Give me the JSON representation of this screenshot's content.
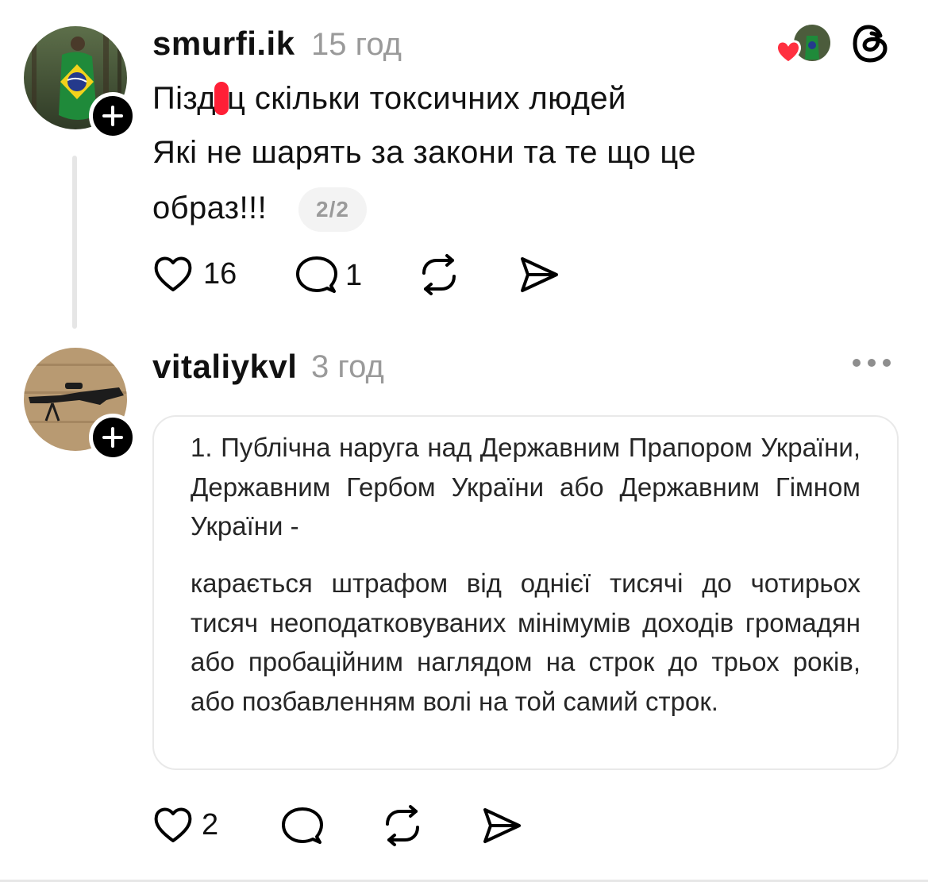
{
  "post1": {
    "username": "smurfi.ik",
    "time": "15 год",
    "line1_before": "Пізд",
    "line1_after": "ц скільки токсичних людей",
    "line2": "Які не шарять за закони та те що це",
    "line3": "образ!!!",
    "pager": "2/2",
    "likes": "16",
    "replies": "1"
  },
  "post2": {
    "username": "vitaliykvl",
    "time": "3 год",
    "quote_para1": "1. Публічна наруга над Державним Прапором України, Державним Гербом України або Державним Гімном України -",
    "quote_para2": "карається штрафом від однієї тисячі до чотирьох тисяч неоподатковуваних мінімумів доходів громадян або пробаційним наглядом на строк до трьох років, або позбавленням волі на той самий строк.",
    "likes": "2"
  },
  "icons": [
    "heart-icon",
    "comment-icon",
    "repost-icon",
    "share-icon",
    "threads-logo-icon",
    "more-icon",
    "plus-icon"
  ],
  "colors": {
    "text": "#111111",
    "muted": "#9a9a9a",
    "redaction": "#ff1f36",
    "like_heart": "#ff3040"
  }
}
